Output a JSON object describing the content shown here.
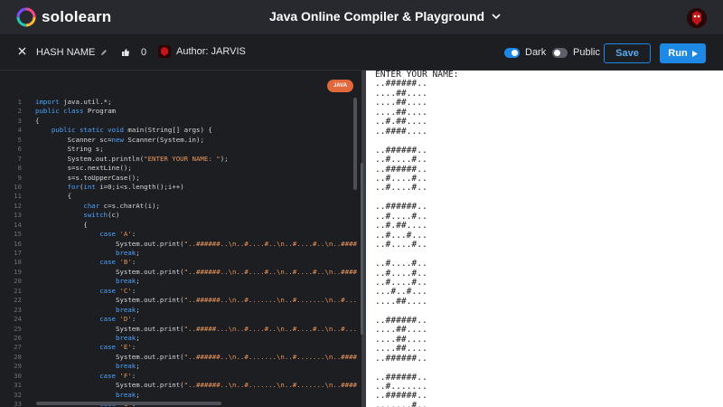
{
  "nav": {
    "brand": "sololearn",
    "title": "Java Online Compiler & Playground"
  },
  "toolbar": {
    "code_name": "HASH NAME",
    "likes": "0",
    "author": "Author: JARVIS",
    "dark_label": "Dark",
    "public_label": "Public",
    "save_label": "Save",
    "run_label": "Run"
  },
  "editor": {
    "language": "JAVA",
    "lines": [
      {
        "n": "1",
        "t": "import java.util.*;"
      },
      {
        "n": "2",
        "t": "public class Program"
      },
      {
        "n": "3",
        "t": "{"
      },
      {
        "n": "4",
        "t": "    public static void main(String[] args) {"
      },
      {
        "n": "5",
        "t": "        Scanner sc=new Scanner(System.in);"
      },
      {
        "n": "6",
        "t": "        String s;"
      },
      {
        "n": "7",
        "t": "        System.out.println(\"ENTER YOUR NAME: \");"
      },
      {
        "n": "8",
        "t": "        s=sc.nextLine();"
      },
      {
        "n": "9",
        "t": "        s=s.toUpperCase();"
      },
      {
        "n": "10",
        "t": "        for(int i=0;i<s.length();i++)"
      },
      {
        "n": "11",
        "t": "        {"
      },
      {
        "n": "12",
        "t": "            char c=s.charAt(i);"
      },
      {
        "n": "13",
        "t": "            switch(c)"
      },
      {
        "n": "14",
        "t": "            {"
      },
      {
        "n": "15",
        "t": "                case 'A':"
      },
      {
        "n": "16",
        "t": "                    System.out.print(\"..######..\\n..#....#..\\n..#....#..\\n..######..\\n..#"
      },
      {
        "n": "17",
        "t": "                    break;"
      },
      {
        "n": "18",
        "t": "                case 'B':"
      },
      {
        "n": "19",
        "t": "                    System.out.print(\"..######..\\n..#....#..\\n..#....#..\\n..######..\\n..#"
      },
      {
        "n": "20",
        "t": "                    break;"
      },
      {
        "n": "21",
        "t": "                case 'C':"
      },
      {
        "n": "22",
        "t": "                    System.out.print(\"..######..\\n..#.......\\n..#.......\\n..#.......\\n..#"
      },
      {
        "n": "23",
        "t": "                    break;"
      },
      {
        "n": "24",
        "t": "                case 'D':"
      },
      {
        "n": "25",
        "t": "                    System.out.print(\"..#####...\\n..#....#..\\n..#....#..\\n..#....#..\\n..#"
      },
      {
        "n": "26",
        "t": "                    break;"
      },
      {
        "n": "27",
        "t": "                case 'E':"
      },
      {
        "n": "28",
        "t": "                    System.out.print(\"..######..\\n..#.......\\n..#.......\\n..######..\\n..#"
      },
      {
        "n": "29",
        "t": "                    break;"
      },
      {
        "n": "30",
        "t": "                case 'F':"
      },
      {
        "n": "31",
        "t": "                    System.out.print(\"..######..\\n..#.......\\n..#.......\\n..######..\\n..#"
      },
      {
        "n": "32",
        "t": "                    break;"
      },
      {
        "n": "33",
        "t": "                case 'G':"
      }
    ]
  },
  "output": {
    "text": "ENTER YOUR NAME:\n..######..\n....##....\n....##....\n....##....\n..#.##....\n..####....\n\n..######..\n..#....#..\n..######..\n..#....#..\n..#....#..\n\n..######..\n..#....#..\n..#.##....\n..#...#...\n..#....#..\n\n..#....#..\n..#....#..\n..#....#..\n...#..#...\n....##....\n\n..######..\n....##....\n....##....\n....##....\n..######..\n\n..######..\n..#.......\n..######..\n.......#..\n..######.."
  },
  "colors": {
    "accent": "#1e88e5",
    "java_badge": "#e2673b",
    "keyword": "#4ea3ff",
    "string": "#e9955a"
  }
}
